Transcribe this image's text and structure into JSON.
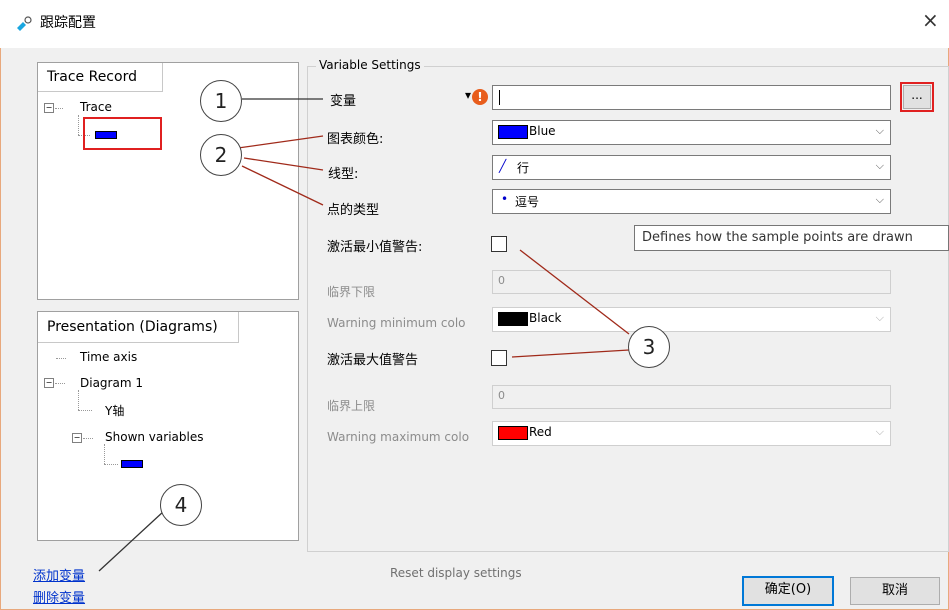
{
  "window": {
    "title": "跟踪配置",
    "close_glyph": "×"
  },
  "trace_record": {
    "tab": "Trace Record",
    "tree": {
      "root_label": "Trace",
      "expand_glyph": "−"
    }
  },
  "presentation": {
    "tab": "Presentation (Diagrams)",
    "items": {
      "time_axis": "Time axis",
      "diagram": "Diagram 1",
      "y_axis": "Y轴",
      "shown_variables": "Shown variables"
    },
    "expand_glyph": "−"
  },
  "variable_settings": {
    "group_title": "Variable Settings",
    "variable_label": "变量",
    "variable_value": "",
    "browse_label": "...",
    "chart_color_label": "图表颜色:",
    "chart_color_value": "Blue",
    "line_type_label": "线型:",
    "line_type_value": "行",
    "line_type_glyph": "╱",
    "point_type_label": "点的类型",
    "point_type_value": "逗号",
    "point_type_glyph": "•",
    "warn_min_label": "激活最小值警告:",
    "lower_limit_label": "临界下限",
    "lower_limit_value": "0",
    "warn_min_color_label": "Warning minimum colo",
    "warn_min_color_value": "Black",
    "warn_max_label": "激活最大值警告",
    "upper_limit_label": "临界上限",
    "upper_limit_value": "0",
    "warn_max_color_label": "Warning maximum colo",
    "warn_max_color_value": "Red",
    "tooltip": "Defines how the sample points are drawn",
    "chevron_glyph": "⌵",
    "dropdown_glyph": "▾",
    "error_glyph": "!"
  },
  "footer": {
    "add_variable": "添加变量",
    "delete_variable": "删除变量",
    "reset_display": "Reset display settings",
    "ok": "确定(O)",
    "cancel": "取消"
  },
  "callouts": {
    "c1": "1",
    "c2": "2",
    "c3": "3",
    "c4": "4"
  },
  "colors": {
    "blue": "#0000ff",
    "black": "#000000",
    "red": "#ff0000",
    "highlight_red": "#e02020",
    "link_blue": "#0033cc",
    "focus_blue": "#0078d7",
    "error_orange": "#e85d1c"
  },
  "icons": {
    "app_icon": "app-icon",
    "close": "close-icon",
    "error": "error-icon",
    "dropdown": "dropdown-arrow-icon"
  }
}
